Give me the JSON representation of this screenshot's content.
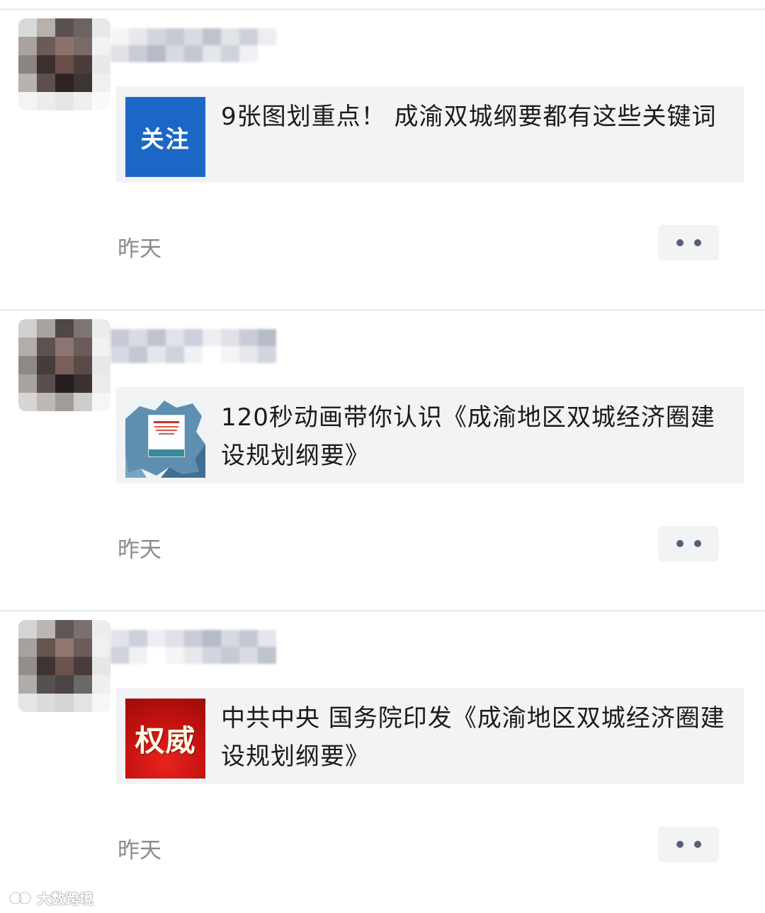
{
  "posts": [
    {
      "thumbnail_text": "关注",
      "thumbnail_color": "#1c67c6",
      "title": "9张图划重点！ 成渝双城纲要都有这些关键词",
      "time": "昨天"
    },
    {
      "thumbnail_text": "",
      "thumbnail_icon": "map-thumbnail",
      "title": "120秒动画带你认识《成渝地区双城经济圈建设规划纲要》",
      "time": "昨天"
    },
    {
      "thumbnail_text": "权威",
      "thumbnail_color": "#c4120f",
      "title": "中共中央 国务院印发《成渝地区双城经济圈建设规划纲要》",
      "time": "昨天"
    }
  ],
  "more_icon": "more-dots-icon",
  "watermark": "大数跨境"
}
